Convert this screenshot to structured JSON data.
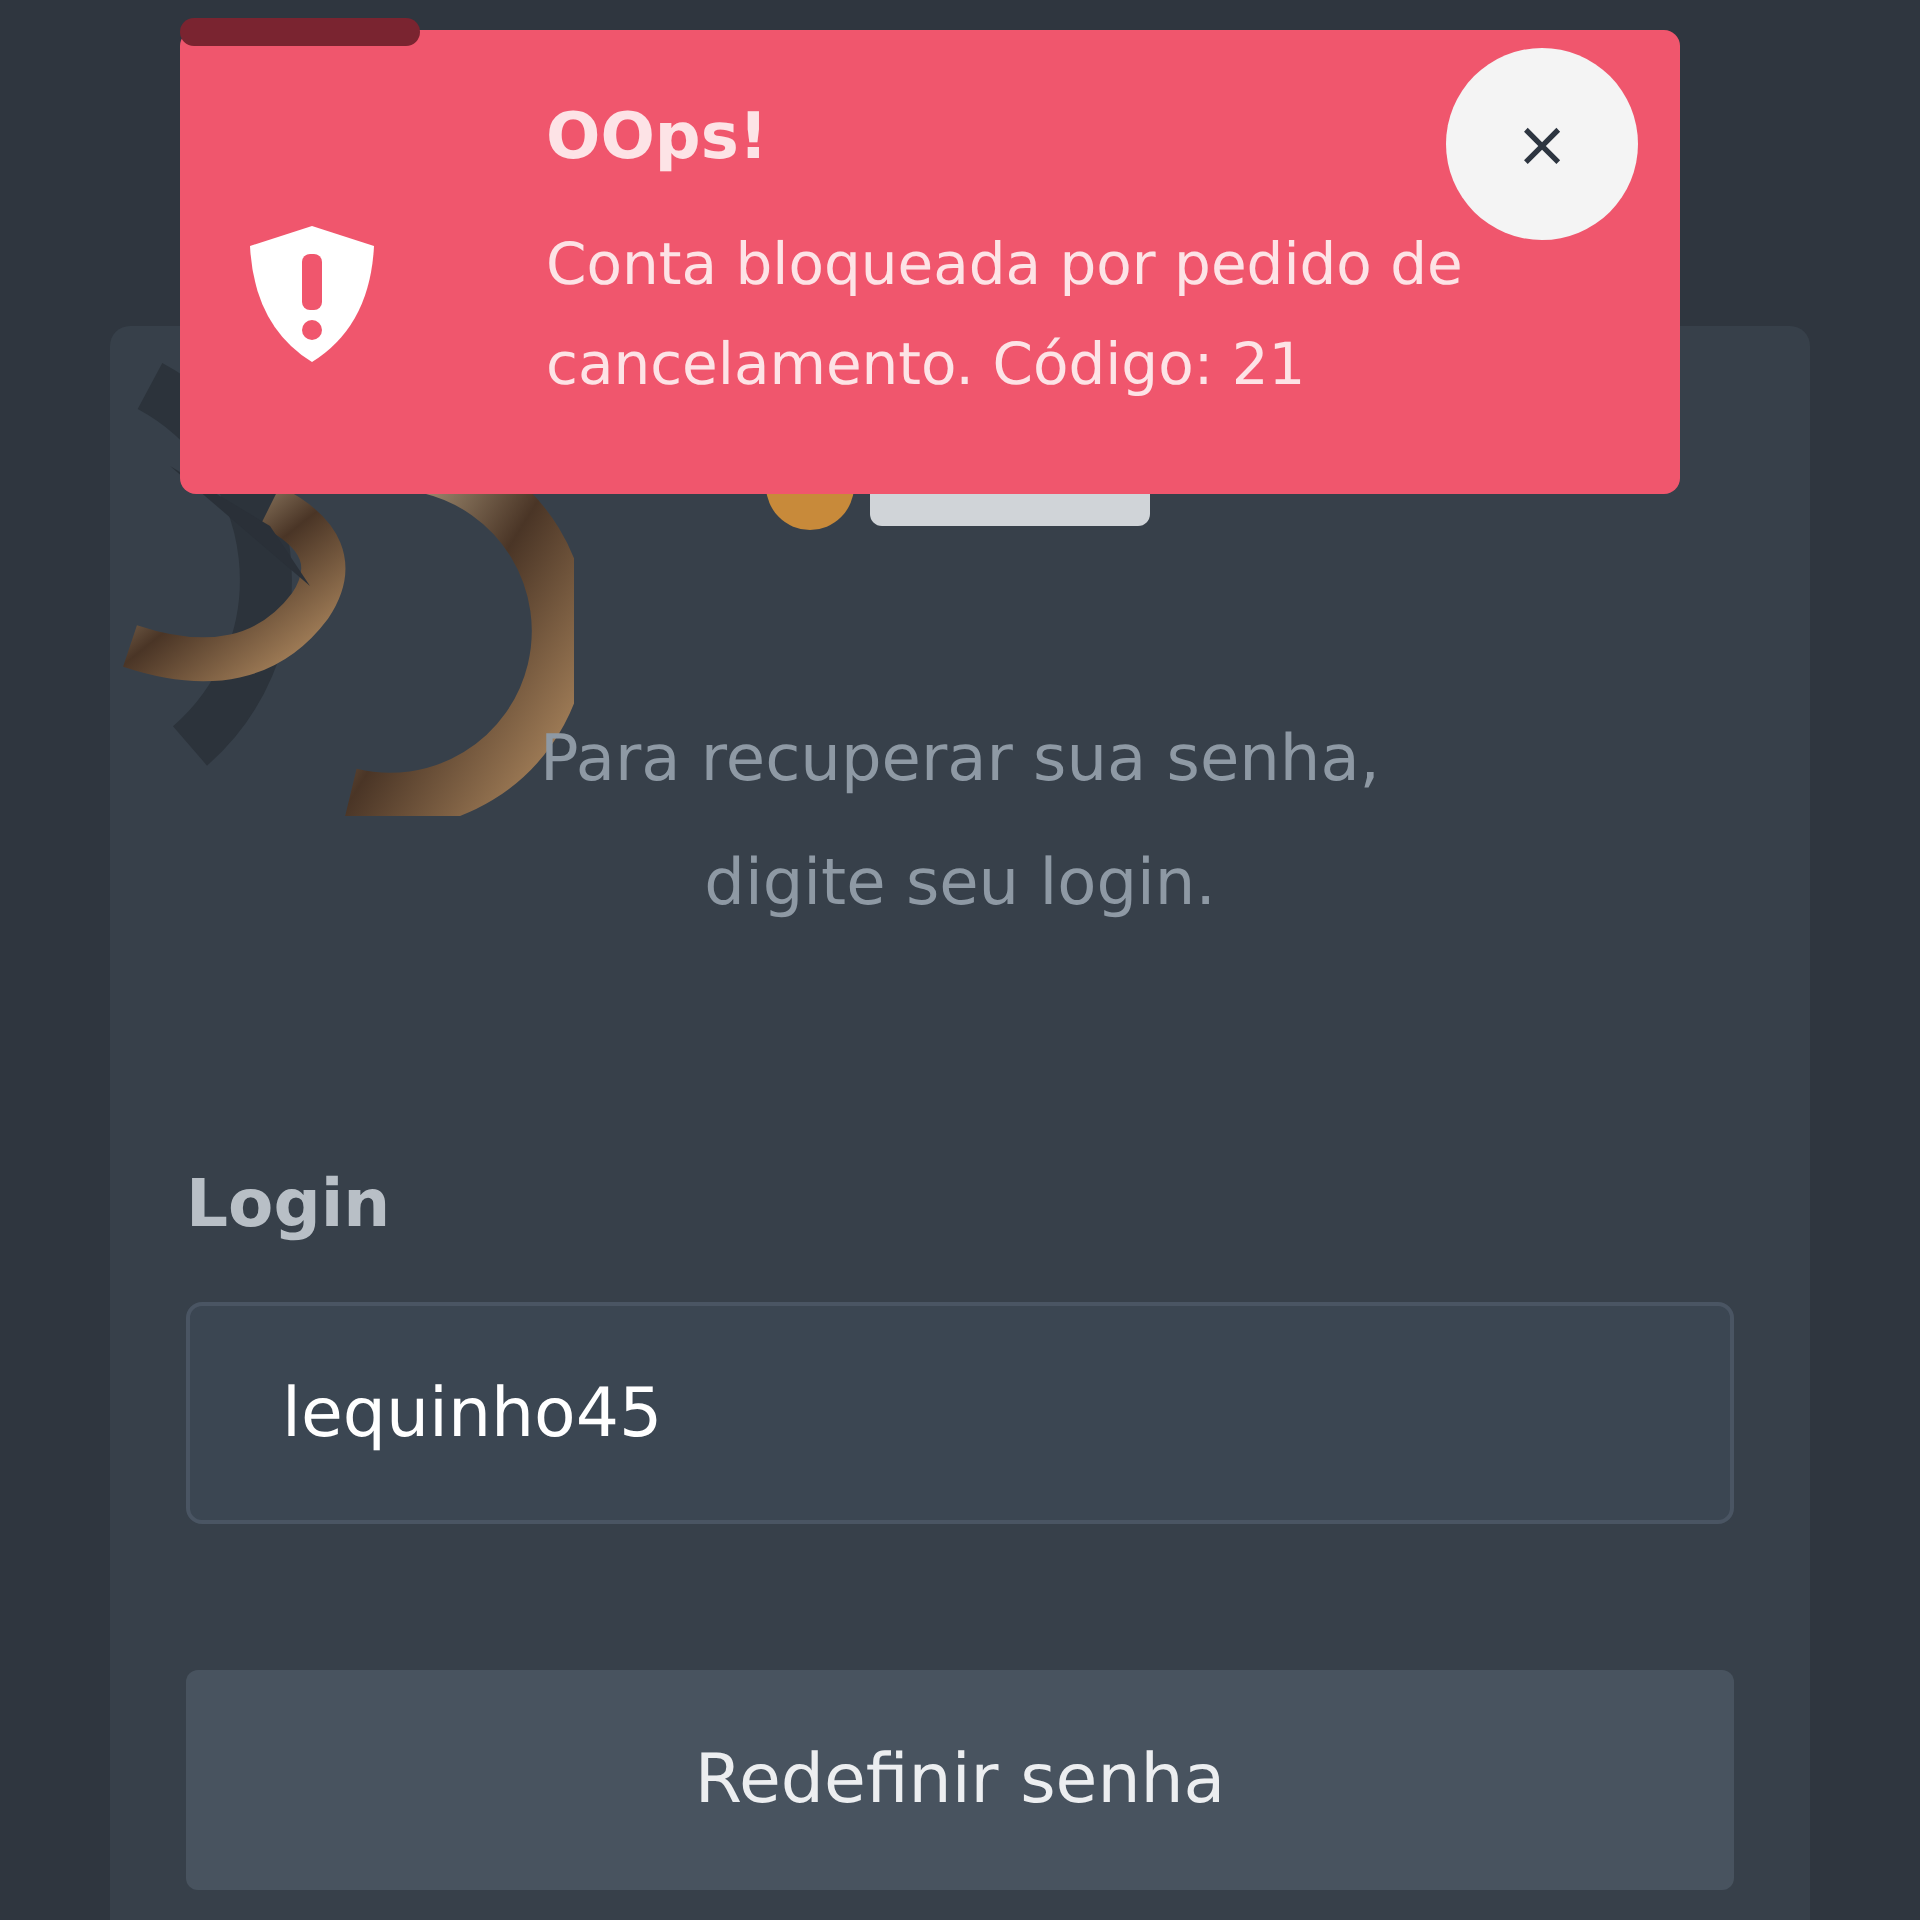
{
  "toast": {
    "title": "OOps!",
    "message": "Conta bloqueada por pedido de cancelamento. Código: 21",
    "timer": {
      "level": 0.16
    },
    "close": "×"
  },
  "form": {
    "instructions": "Para recuperar sua senha, digite seu login.",
    "login_label": "Login",
    "login_value": "lequinho45",
    "submit": "Redefinir senha"
  }
}
